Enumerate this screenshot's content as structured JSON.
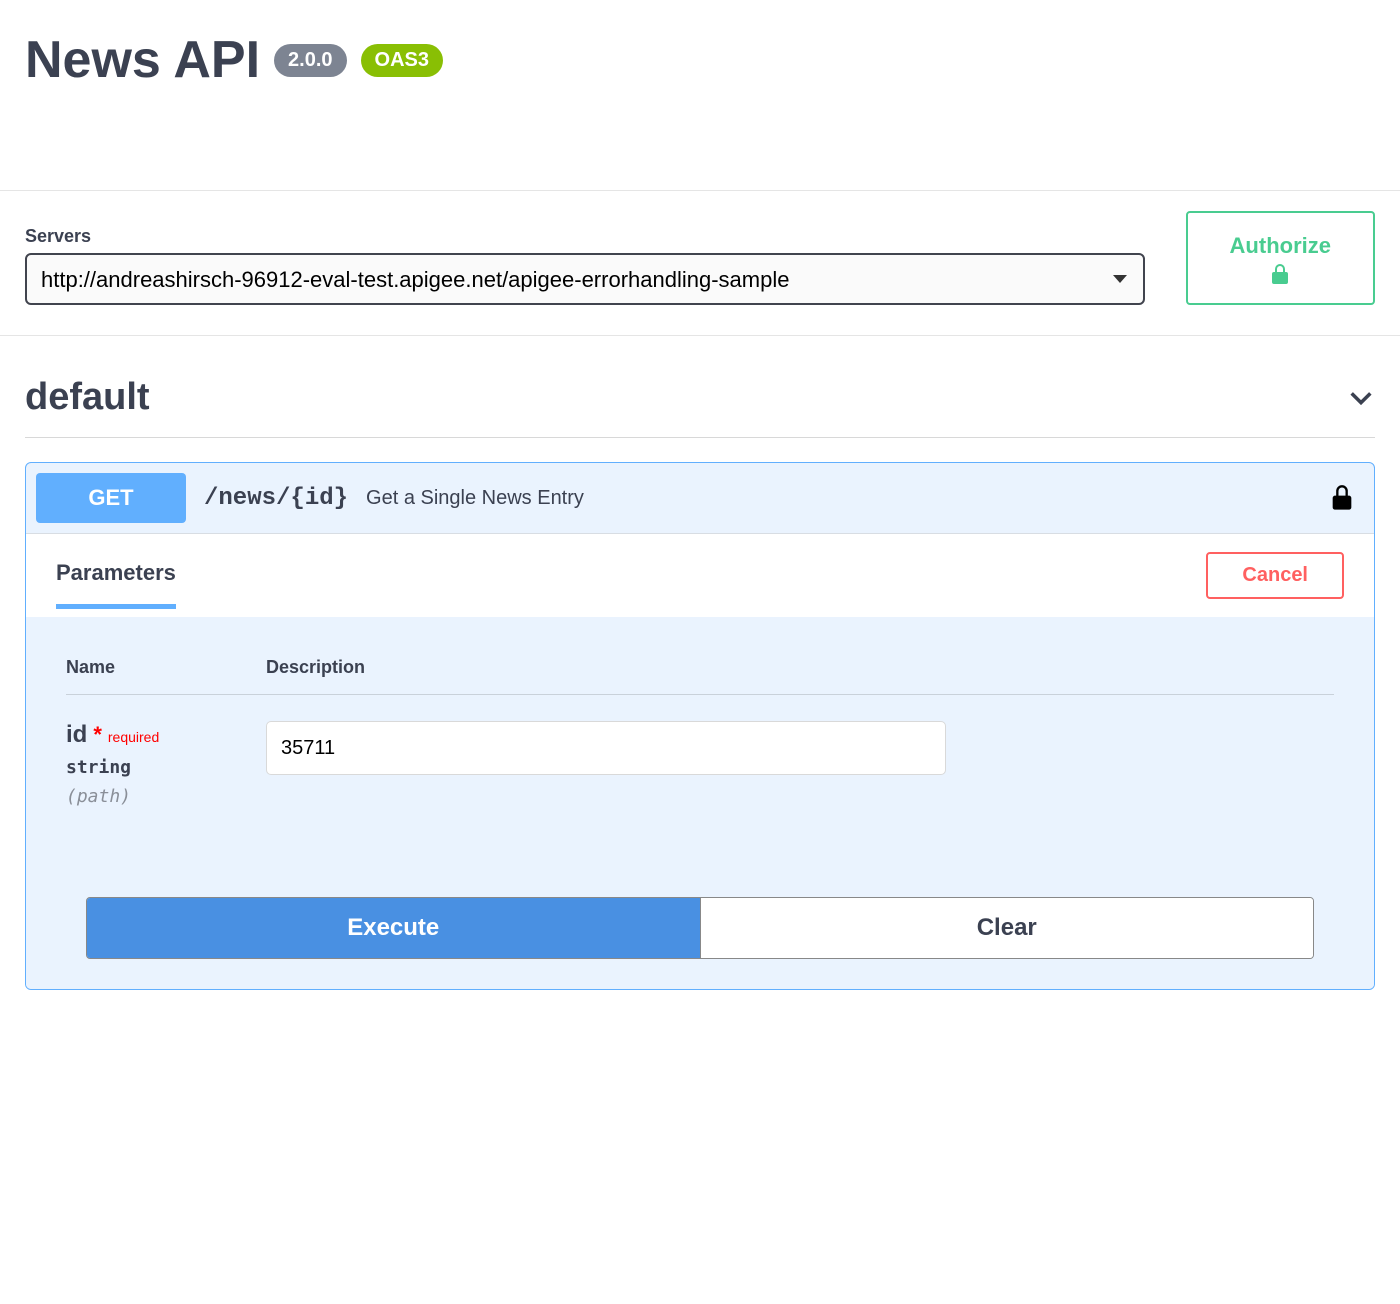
{
  "header": {
    "title": "News API",
    "version": "2.0.0",
    "spec_badge": "OAS3"
  },
  "servers": {
    "label": "Servers",
    "selected": "http://andreashirsch-96912-eval-test.apigee.net/apigee-errorhandling-sample"
  },
  "authorize": {
    "label": "Authorize"
  },
  "tag": {
    "name": "default"
  },
  "operation": {
    "method": "GET",
    "path": "/news/{id}",
    "summary": "Get a Single News Entry"
  },
  "params_section": {
    "tab_label": "Parameters",
    "cancel_label": "Cancel",
    "col_name": "Name",
    "col_desc": "Description"
  },
  "param": {
    "name": "id",
    "required_text": "required",
    "type": "string",
    "in": "(path)",
    "value": "35711"
  },
  "actions": {
    "execute": "Execute",
    "clear": "Clear"
  }
}
